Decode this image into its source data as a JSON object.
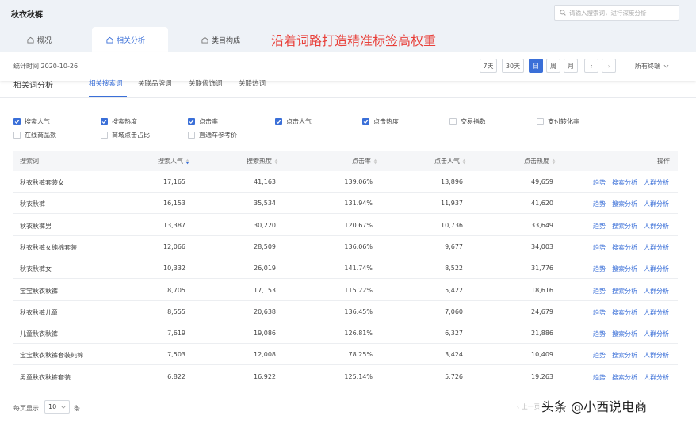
{
  "app": {
    "title": "秋衣秋裤"
  },
  "search": {
    "placeholder": "请输入搜索词，进行深度分析"
  },
  "tabs": [
    {
      "label": "概况"
    },
    {
      "label": "相关分析"
    },
    {
      "label": "类目构成"
    }
  ],
  "overlay_text": "沿着词路打造精准标签高权重",
  "stats": {
    "date_label": "统计时间 2020-10-26"
  },
  "period": {
    "d7": "7天",
    "d30": "30天",
    "day": "日",
    "week": "周",
    "month": "月",
    "prev": "‹",
    "next": "›",
    "terminal": "所有终端"
  },
  "section": {
    "title": "相关词分析",
    "subtabs": [
      {
        "label": "相关搜索词"
      },
      {
        "label": "关联品牌词"
      },
      {
        "label": "关联修饰词"
      },
      {
        "label": "关联热词"
      }
    ]
  },
  "metrics": [
    {
      "label": "搜索人气",
      "checked": true
    },
    {
      "label": "搜索热度",
      "checked": true
    },
    {
      "label": "点击率",
      "checked": true
    },
    {
      "label": "点击人气",
      "checked": true
    },
    {
      "label": "点击热度",
      "checked": true
    },
    {
      "label": "交易指数",
      "checked": false
    },
    {
      "label": "支付转化率",
      "checked": false
    },
    {
      "label": "在线商品数",
      "checked": false
    },
    {
      "label": "商城点击占比",
      "checked": false
    },
    {
      "label": "直通车参考价",
      "checked": false
    }
  ],
  "table": {
    "headers": {
      "keyword": "搜索词",
      "search_pop": "搜索人气",
      "search_heat": "搜索热度",
      "ctr": "点击率",
      "click_pop": "点击人气",
      "click_heat": "点击热度",
      "ops": "操作"
    },
    "rows": [
      {
        "keyword": "秋衣秋裤套装女",
        "search_pop": "17,165",
        "search_heat": "41,163",
        "ctr": "139.06%",
        "click_pop": "13,896",
        "click_heat": "49,659"
      },
      {
        "keyword": "秋衣秋裤",
        "search_pop": "16,153",
        "search_heat": "35,534",
        "ctr": "131.94%",
        "click_pop": "11,937",
        "click_heat": "41,620"
      },
      {
        "keyword": "秋衣秋裤男",
        "search_pop": "13,387",
        "search_heat": "30,220",
        "ctr": "120.67%",
        "click_pop": "10,736",
        "click_heat": "33,649"
      },
      {
        "keyword": "秋衣秋裤女纯棉套装",
        "search_pop": "12,066",
        "search_heat": "28,509",
        "ctr": "136.06%",
        "click_pop": "9,677",
        "click_heat": "34,003"
      },
      {
        "keyword": "秋衣秋裤女",
        "search_pop": "10,332",
        "search_heat": "26,019",
        "ctr": "141.74%",
        "click_pop": "8,522",
        "click_heat": "31,776"
      },
      {
        "keyword": "宝宝秋衣秋裤",
        "search_pop": "8,705",
        "search_heat": "17,153",
        "ctr": "115.22%",
        "click_pop": "5,422",
        "click_heat": "18,616"
      },
      {
        "keyword": "秋衣秋裤儿童",
        "search_pop": "8,555",
        "search_heat": "20,638",
        "ctr": "136.45%",
        "click_pop": "7,060",
        "click_heat": "24,679"
      },
      {
        "keyword": "儿童秋衣秋裤",
        "search_pop": "7,619",
        "search_heat": "19,086",
        "ctr": "126.81%",
        "click_pop": "6,327",
        "click_heat": "21,886"
      },
      {
        "keyword": "宝宝秋衣秋裤套装纯棉",
        "search_pop": "7,503",
        "search_heat": "12,008",
        "ctr": "78.25%",
        "click_pop": "3,424",
        "click_heat": "10,409"
      },
      {
        "keyword": "男童秋衣秋裤套装",
        "search_pop": "6,822",
        "search_heat": "16,922",
        "ctr": "125.14%",
        "click_pop": "5,726",
        "click_heat": "19,263"
      }
    ],
    "ops": {
      "trend": "趋势",
      "search_analysis": "搜索分析",
      "crowd_analysis": "人群分析"
    }
  },
  "pagination": {
    "per_page_label": "每页显示",
    "per_page_value": "10",
    "per_page_unit": "条",
    "prev_label": "‹ 上一页"
  },
  "watermark": "头条 @小西说电商",
  "colors": {
    "accent": "#3a6fd8",
    "overlay_red": "#e8403a",
    "header_bg": "#eef2f7"
  }
}
